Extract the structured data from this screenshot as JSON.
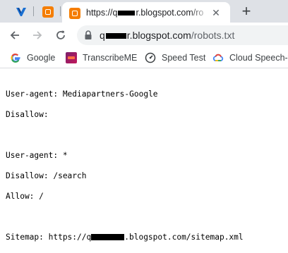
{
  "tabs": {
    "pinned": [
      {
        "name": "v-logo-tab"
      },
      {
        "name": "blogger-tab"
      }
    ],
    "active": {
      "title": "https://q",
      "title_tail": "r.blogspot.com/ro",
      "close_symbol": "✕"
    },
    "new_tab_symbol": "+"
  },
  "toolbar": {
    "url_host_prefix": "q",
    "url_host_suffix": "r.blogspot.com",
    "url_path": "/robots.txt"
  },
  "bookmarks": [
    {
      "label": "Google",
      "icon": "google-icon"
    },
    {
      "label": "TranscribeME",
      "icon": "transcribeme-icon"
    },
    {
      "label": "Speed Test",
      "icon": "speedtest-icon"
    },
    {
      "label": "Cloud Speech-t",
      "icon": "google-cloud-icon"
    }
  ],
  "robots": {
    "block1_agent": "User-agent: Mediapartners-Google",
    "block1_disallow": "Disallow:",
    "block2_agent": "User-agent: *",
    "block2_disallow": "Disallow: /search",
    "block2_allow": "Allow: /",
    "sitemap_prefix": "Sitemap: https://q",
    "sitemap_suffix": ".blogspot.com/sitemap.xml"
  },
  "colors": {
    "tabstrip": "#dee1e6",
    "omnibox": "#f1f3f4",
    "blogger_orange": "#f57d00"
  }
}
